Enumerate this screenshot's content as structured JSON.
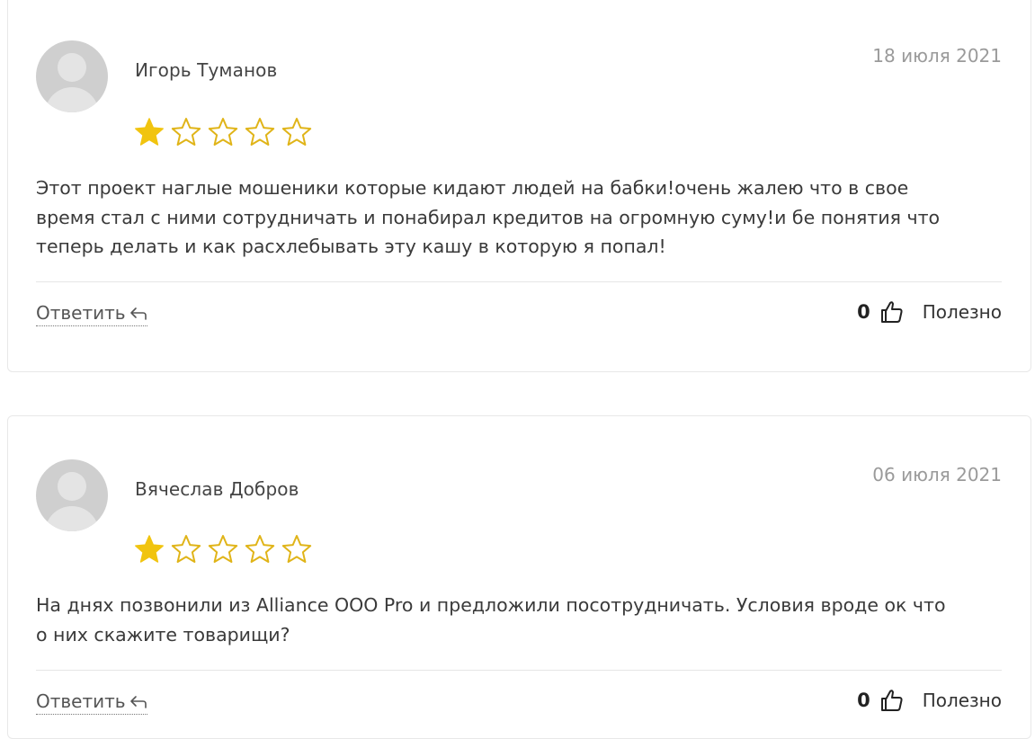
{
  "reviews": [
    {
      "author": "Игорь Туманов",
      "date": "18 июля 2021",
      "rating": 1,
      "rating_max": 5,
      "text_lines": [
        "Этот проект наглые мошеники которые кидают людей на бабки!очень жалею что в свое",
        "время стал с ними сотрудничать и понабирал кредитов на огромную суму!и бе понятия что",
        "теперь делать и как расхлебывать эту кашу в которую я попал!"
      ],
      "reply_label": "Ответить",
      "useful_count": "0",
      "useful_label": "Полезно"
    },
    {
      "author": "Вячеслав Добров",
      "date": "06 июля 2021",
      "rating": 1,
      "rating_max": 5,
      "text_lines": [
        "На днях позвонили из Alliance OOO Pro и предложили посотрудничать. Условия вроде ок что",
        "о них скажите товарищи?"
      ],
      "reply_label": "Ответить",
      "useful_count": "0",
      "useful_label": "Полезно"
    }
  ],
  "colors": {
    "star_filled": "#f1c40f",
    "star_outline": "#e0b418",
    "avatar_bg": "#cfcfcf",
    "border": "#e8e8e8"
  },
  "icons": {
    "reply": "reply-arrow-icon",
    "like": "thumbs-up-icon",
    "star": "star-icon",
    "avatar": "user-avatar-icon"
  }
}
